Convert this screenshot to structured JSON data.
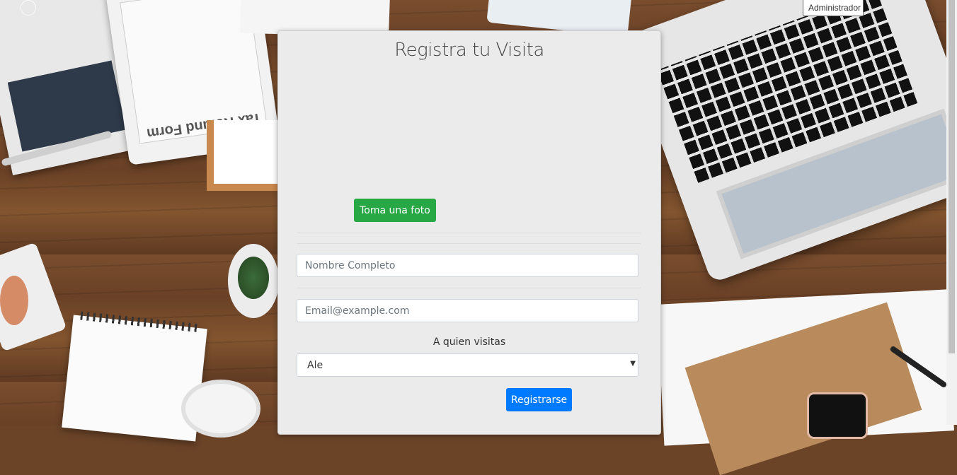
{
  "page": {
    "title": "Registra tu Visita",
    "admin_button_label": "Administrador"
  },
  "form": {
    "photo_button_label": "Toma una foto",
    "name_placeholder": "Nombre Completo",
    "email_placeholder": "Email@example.com",
    "visit_label": "A quien visitas",
    "visit_selected": "Ale",
    "submit_label": "Registrarse"
  },
  "background": {
    "tax_form_text": "Tax Refund Form"
  },
  "colors": {
    "photo_button": "#28a745",
    "submit_button": "#007bff",
    "card_background": "#ebebeb"
  }
}
